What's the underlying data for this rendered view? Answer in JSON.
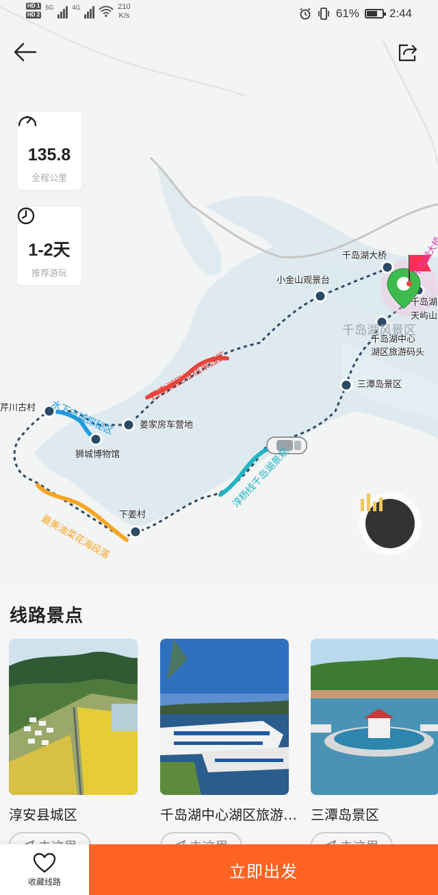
{
  "status_bar": {
    "hd1": "HD 1",
    "hd2": "HD 2",
    "net1": "5G",
    "net2": "4G",
    "speed_value": "210",
    "speed_unit": "K/s",
    "battery_percent": "61%",
    "time": "2:44"
  },
  "stats": {
    "distance_value": "135.8",
    "distance_label": "全程公里",
    "duration_value": "1-2天",
    "duration_label": "推荐游玩"
  },
  "map": {
    "area_label": "千岛湖风景区",
    "stops": {
      "qiandaohu_bridge": "千岛湖大桥",
      "xiaojinshan": "小金山观景台",
      "qiandaohu_tianyu_1": "千岛湖",
      "qiandaohu_tianyu_2": "天屿山",
      "center_pier_1": "千岛湖中心",
      "center_pier_2": "湖区旅游码头",
      "santandao": "三潭岛景区",
      "jiangjia_camp": "姜家房车营地",
      "shicheng_museum": "狮城博物馆",
      "xiajiang": "下姜村",
      "qianchuan": "芹川古村"
    },
    "segments": {
      "red": "西南湖区柑桔果园区",
      "blue": "水下古城探秘区",
      "orange": "最美油菜花海段落",
      "teal": "淳杨线千岛湖景观",
      "pink": "千岛湖大桥"
    },
    "colors": {
      "red": "#e8443a",
      "blue": "#1e9ae0",
      "orange": "#f5a623",
      "teal": "#1fb5c4",
      "route_dash": "#2c4a66",
      "water": "#dbe8ef",
      "accent": "#ff6323"
    }
  },
  "section_title": "线路景点",
  "spots": [
    {
      "name": "淳安县城区",
      "go_label": "去这里"
    },
    {
      "name": "千岛湖中心湖区旅游码头",
      "go_label": "去这里"
    },
    {
      "name": "三潭岛景区",
      "go_label": "去这里"
    }
  ],
  "bottom": {
    "fav_label": "收藏线路",
    "go_label": "立即出发"
  }
}
